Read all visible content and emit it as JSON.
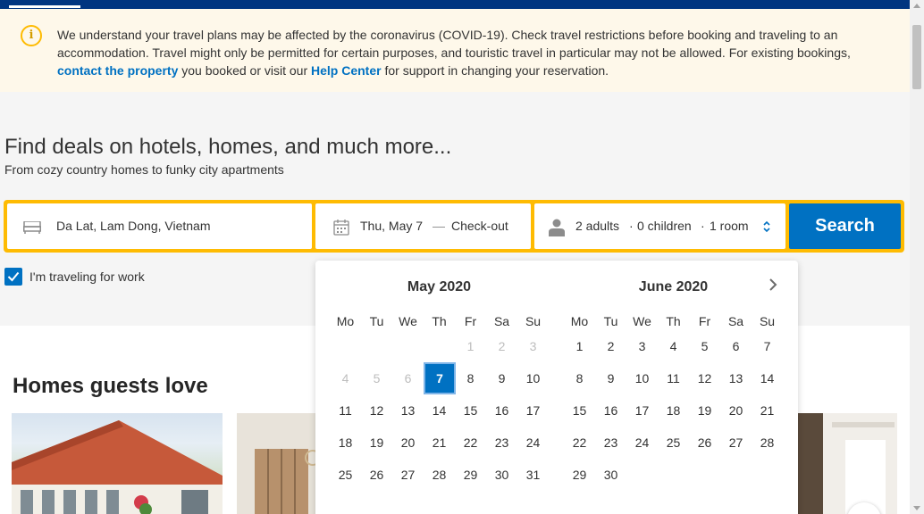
{
  "banner": {
    "text_before": "We understand your travel plans may be affected by the coronavirus (COVID-19). Check travel restrictions before booking and traveling to an accommodation. Travel might only be permitted for certain purposes, and touristic travel in particular may not be allowed. For existing bookings, ",
    "link1": "contact the property",
    "text_middle": " you booked or visit our ",
    "link2": "Help Center",
    "text_after": " for support in changing your reservation.",
    "icon": "info-icon"
  },
  "hero": {
    "title": "Find deals on hotels, homes, and much more...",
    "subtitle": "From cozy country homes to funky city apartments"
  },
  "search": {
    "destination": "Da Lat, Lam Dong, Vietnam",
    "checkin": "Thu, May 7",
    "date_separator": "—",
    "checkout": "Check-out",
    "adults": "2 adults",
    "dot1": "·",
    "children": "0 children",
    "dot2": "·",
    "rooms": "1 room",
    "button": "Search"
  },
  "work_travel": {
    "label": "I'm traveling for work",
    "checked": true
  },
  "homes_section": {
    "title": "Homes guests love"
  },
  "calendar": {
    "weekdays": [
      "Mo",
      "Tu",
      "We",
      "Th",
      "Fr",
      "Sa",
      "Su"
    ],
    "months": [
      {
        "title": "May 2020",
        "days": [
          {
            "d": "",
            "s": "empty"
          },
          {
            "d": "",
            "s": "empty"
          },
          {
            "d": "",
            "s": "empty"
          },
          {
            "d": "",
            "s": "empty"
          },
          {
            "d": "1",
            "s": "disabled"
          },
          {
            "d": "2",
            "s": "disabled"
          },
          {
            "d": "3",
            "s": "disabled"
          },
          {
            "d": "4",
            "s": "disabled"
          },
          {
            "d": "5",
            "s": "disabled"
          },
          {
            "d": "6",
            "s": "disabled"
          },
          {
            "d": "7",
            "s": "selected"
          },
          {
            "d": "8",
            "s": ""
          },
          {
            "d": "9",
            "s": ""
          },
          {
            "d": "10",
            "s": ""
          },
          {
            "d": "11",
            "s": ""
          },
          {
            "d": "12",
            "s": ""
          },
          {
            "d": "13",
            "s": ""
          },
          {
            "d": "14",
            "s": ""
          },
          {
            "d": "15",
            "s": ""
          },
          {
            "d": "16",
            "s": ""
          },
          {
            "d": "17",
            "s": ""
          },
          {
            "d": "18",
            "s": ""
          },
          {
            "d": "19",
            "s": ""
          },
          {
            "d": "20",
            "s": ""
          },
          {
            "d": "21",
            "s": ""
          },
          {
            "d": "22",
            "s": ""
          },
          {
            "d": "23",
            "s": ""
          },
          {
            "d": "24",
            "s": ""
          },
          {
            "d": "25",
            "s": ""
          },
          {
            "d": "26",
            "s": ""
          },
          {
            "d": "27",
            "s": ""
          },
          {
            "d": "28",
            "s": ""
          },
          {
            "d": "29",
            "s": ""
          },
          {
            "d": "30",
            "s": ""
          },
          {
            "d": "31",
            "s": ""
          }
        ]
      },
      {
        "title": "June 2020",
        "days": [
          {
            "d": "1",
            "s": ""
          },
          {
            "d": "2",
            "s": ""
          },
          {
            "d": "3",
            "s": ""
          },
          {
            "d": "4",
            "s": ""
          },
          {
            "d": "5",
            "s": ""
          },
          {
            "d": "6",
            "s": ""
          },
          {
            "d": "7",
            "s": ""
          },
          {
            "d": "8",
            "s": ""
          },
          {
            "d": "9",
            "s": ""
          },
          {
            "d": "10",
            "s": ""
          },
          {
            "d": "11",
            "s": ""
          },
          {
            "d": "12",
            "s": ""
          },
          {
            "d": "13",
            "s": ""
          },
          {
            "d": "14",
            "s": ""
          },
          {
            "d": "15",
            "s": ""
          },
          {
            "d": "16",
            "s": ""
          },
          {
            "d": "17",
            "s": ""
          },
          {
            "d": "18",
            "s": ""
          },
          {
            "d": "19",
            "s": ""
          },
          {
            "d": "20",
            "s": ""
          },
          {
            "d": "21",
            "s": ""
          },
          {
            "d": "22",
            "s": ""
          },
          {
            "d": "23",
            "s": ""
          },
          {
            "d": "24",
            "s": ""
          },
          {
            "d": "25",
            "s": ""
          },
          {
            "d": "26",
            "s": ""
          },
          {
            "d": "27",
            "s": ""
          },
          {
            "d": "28",
            "s": ""
          },
          {
            "d": "29",
            "s": ""
          },
          {
            "d": "30",
            "s": ""
          }
        ]
      }
    ]
  },
  "colors": {
    "brand_dark": "#003580",
    "accent_blue": "#0071c2",
    "search_frame": "#febb02",
    "banner_bg": "#fef8ea"
  }
}
